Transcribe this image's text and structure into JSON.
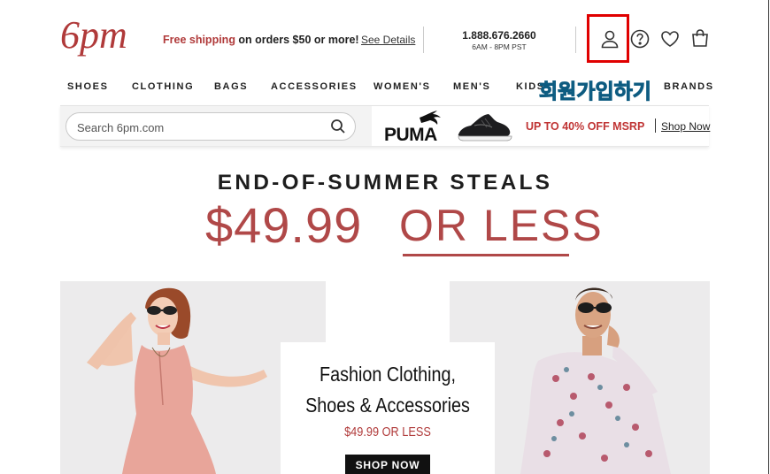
{
  "header": {
    "logo_text": "6pm",
    "promo_free": "Free shipping",
    "promo_rest": " on orders $50 or more!",
    "promo_details": "See Details",
    "phone_number": "1.888.676.2660",
    "phone_hours": "6AM - 8PM PST",
    "icons": [
      "user-icon",
      "help-icon",
      "heart-icon",
      "bag-icon"
    ]
  },
  "annotation": {
    "korean_label": "회원가입하기",
    "box_color": "#e00000"
  },
  "nav": {
    "items": [
      "SHOES",
      "CLOTHING",
      "BAGS",
      "ACCESSORIES",
      "WOMEN'S",
      "MEN'S",
      "KIDS",
      "BRANDS"
    ]
  },
  "search": {
    "placeholder": "Search 6pm.com"
  },
  "banner": {
    "brand": "PUMA",
    "promo": "UP TO 40% OFF MSRP",
    "link": "Shop Now"
  },
  "hero": {
    "headline": "END-OF-SUMMER STEALS",
    "price": "$49.99",
    "or_less": "OR LESS"
  },
  "card": {
    "title_line1": "Fashion Clothing,",
    "title_line2": "Shoes & Accessories",
    "price": "$49.99 OR LESS",
    "button": "SHOP NOW"
  },
  "colors": {
    "brand_red": "#b04848",
    "accent_red": "#c03535"
  }
}
